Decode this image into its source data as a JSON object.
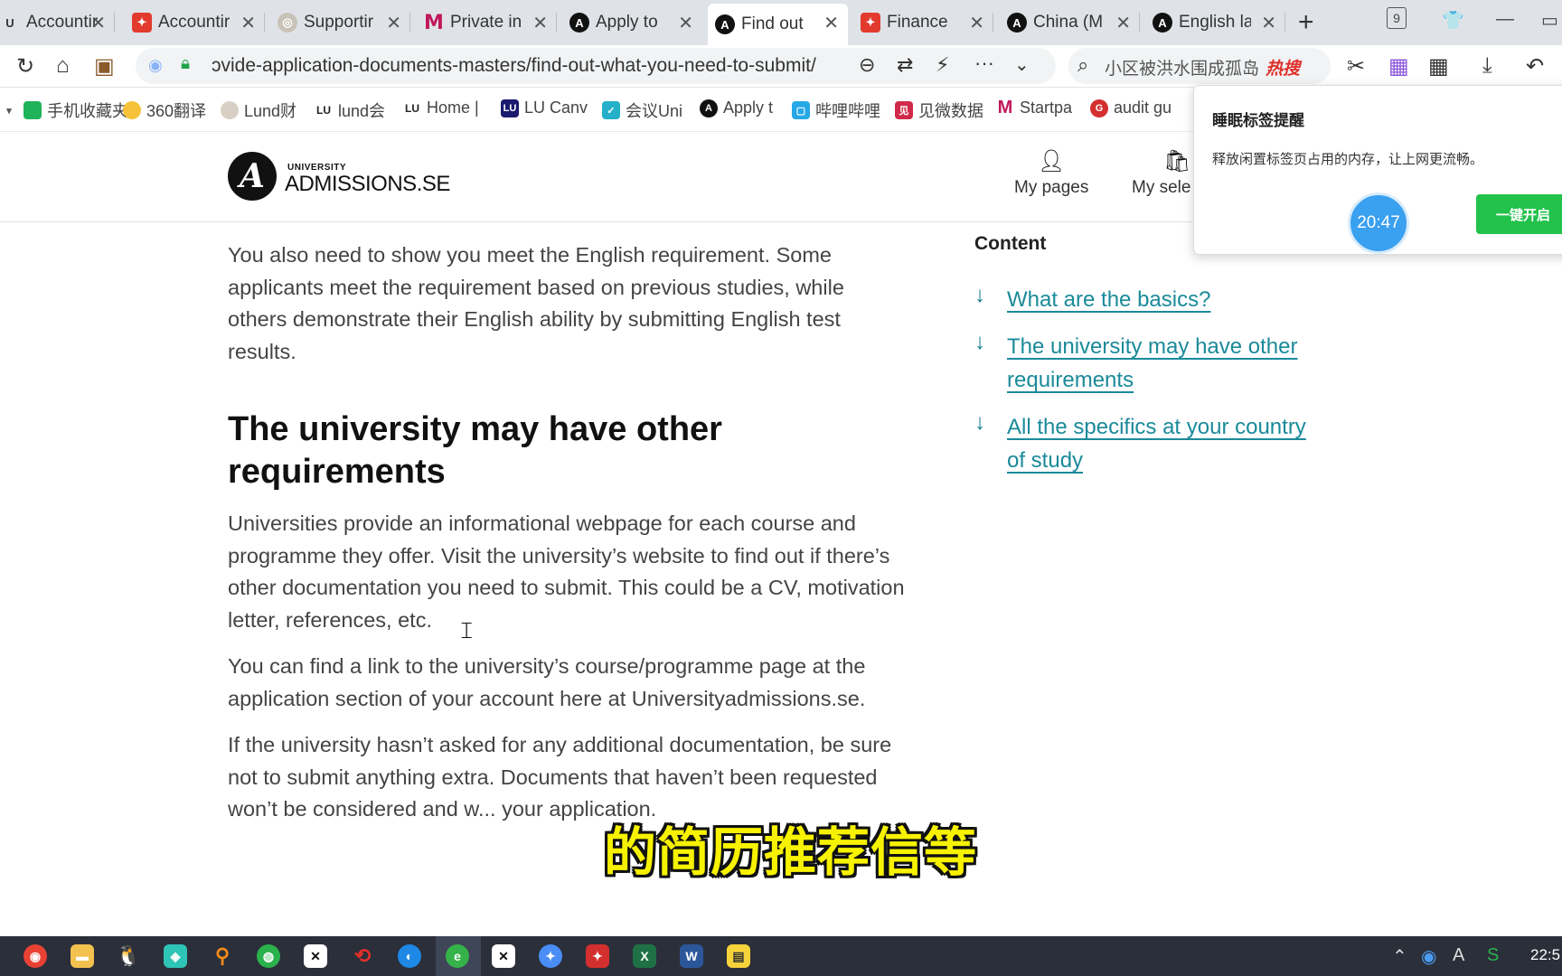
{
  "browser": {
    "tabs": [
      {
        "label": "Accountir",
        "icon": "u-favicon-icon",
        "active": false
      },
      {
        "label": "Accountir",
        "icon": "pdf-icon",
        "active": false
      },
      {
        "label": "Supportir",
        "icon": "support-favicon-icon",
        "active": false
      },
      {
        "label": "Private in",
        "icon": "gmail-icon",
        "active": false
      },
      {
        "label": "Apply to",
        "icon": "admissions-favicon-icon",
        "active": false
      },
      {
        "label": "Find out",
        "icon": "admissions-favicon-icon",
        "active": true
      },
      {
        "label": "Finance",
        "icon": "pdf-icon",
        "active": false
      },
      {
        "label": "China (M",
        "icon": "admissions-favicon-icon",
        "active": false
      },
      {
        "label": "English la",
        "icon": "admissions-favicon-icon",
        "active": false
      }
    ],
    "tab_count_badge": "9",
    "url": "ɔvide-application-documents-masters/find-out-what-you-need-to-submit/",
    "search_placeholder": "小区被洪水围成孤岛",
    "search_hot": "热搜",
    "bookmarks": [
      {
        "label": "手机收藏夹"
      },
      {
        "label": "360翻译"
      },
      {
        "label": "Lund财"
      },
      {
        "label": "lund会"
      },
      {
        "label": "Home |"
      },
      {
        "label": "LU Canv"
      },
      {
        "label": "会议Uni"
      },
      {
        "label": "Apply t"
      },
      {
        "label": "哔哩哔哩"
      },
      {
        "label": "见微数据"
      },
      {
        "label": "Startpa"
      },
      {
        "label": "audit gu"
      }
    ]
  },
  "site": {
    "logo_small": "UNIVERSITY",
    "logo_big": "ADMISSIONS.SE",
    "nav_my_pages": "My pages",
    "nav_my_selections": "My sele"
  },
  "article": {
    "intro": "You also need to show you meet the English requirement. Some applicants meet the requirement based on previous studies, while others demonstrate their English ability by submitting English test results.",
    "heading": "The university may have other requirements",
    "p1": "Universities provide an informational webpage for each course and programme they offer. Visit the university’s website to find out if there’s other documentation you need to submit. This could be a CV, motivation letter, references, etc.",
    "p2": "You can find a link to the university’s course/programme page at the application section of your account here at Universityadmissions.se.",
    "p3": "If the university hasn’t asked for any additional documentation, be sure not to submit anything extra. Documents that haven’t been requested won’t be considered and w... your application."
  },
  "toc": {
    "title": "Content",
    "items": [
      {
        "label": "What are the basics?"
      },
      {
        "label": "The university may have other requirements"
      },
      {
        "label": "All the specifics at your country of study"
      }
    ]
  },
  "popup": {
    "title": "睡眠标签提醒",
    "body": "释放闲置标签页占用的内存，让上网更流畅。",
    "timer": "20:47",
    "button": "一键开启"
  },
  "subtitle": "的简历推荐信等",
  "taskbar": {
    "clock": "22:5"
  }
}
